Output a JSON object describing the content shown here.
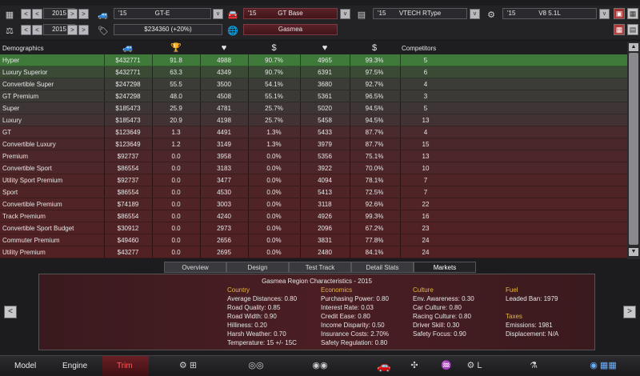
{
  "toolbar": {
    "row1": {
      "year": "2015",
      "model_year": "'15",
      "model": "GT-E",
      "trim_year": "'15",
      "trim": "GT Base",
      "engine_year": "'15",
      "engine": "VTECH RType",
      "engine_family_year": "'15",
      "engine_family": "V8 5.1L"
    },
    "row2": {
      "year": "2015",
      "price": "$234360 (+20%)",
      "region": "Gasmea"
    },
    "prev_glyph": "<",
    "next_glyph": ">",
    "dropdown_glyph": "v"
  },
  "table": {
    "headers": {
      "demographics": "Demographics",
      "competitors": "Competitors"
    },
    "header_icons": [
      "car-icon",
      "trophy-icon",
      "heart-icon",
      "dollar-icon",
      "heart-icon",
      "dollar-icon"
    ],
    "rows": [
      {
        "name": "Hyper",
        "price": "$432771",
        "score": "91.8",
        "appeal": "4988",
        "afford": "90.7%",
        "appeal2": "4965",
        "afford2": "99.3%",
        "competitors": "5"
      },
      {
        "name": "Luxury Superior",
        "price": "$432771",
        "score": "63.3",
        "appeal": "4349",
        "afford": "90.7%",
        "appeal2": "6391",
        "afford2": "97.5%",
        "competitors": "6"
      },
      {
        "name": "Convertible Super",
        "price": "$247298",
        "score": "55.5",
        "appeal": "3500",
        "afford": "54.1%",
        "appeal2": "3680",
        "afford2": "92.7%",
        "competitors": "4"
      },
      {
        "name": "GT Premium",
        "price": "$247298",
        "score": "48.0",
        "appeal": "4508",
        "afford": "55.1%",
        "appeal2": "5361",
        "afford2": "96.5%",
        "competitors": "3"
      },
      {
        "name": "Super",
        "price": "$185473",
        "score": "25.9",
        "appeal": "4781",
        "afford": "25.7%",
        "appeal2": "5020",
        "afford2": "94.5%",
        "competitors": "5"
      },
      {
        "name": "Luxury",
        "price": "$185473",
        "score": "20.9",
        "appeal": "4198",
        "afford": "25.7%",
        "appeal2": "5458",
        "afford2": "94.5%",
        "competitors": "13"
      },
      {
        "name": "GT",
        "price": "$123649",
        "score": "1.3",
        "appeal": "4491",
        "afford": "1.3%",
        "appeal2": "5433",
        "afford2": "87.7%",
        "competitors": "4"
      },
      {
        "name": "Convertible Luxury",
        "price": "$123649",
        "score": "1.2",
        "appeal": "3149",
        "afford": "1.3%",
        "appeal2": "3979",
        "afford2": "87.7%",
        "competitors": "15"
      },
      {
        "name": "Premium",
        "price": "$92737",
        "score": "0.0",
        "appeal": "3958",
        "afford": "0.0%",
        "appeal2": "5356",
        "afford2": "75.1%",
        "competitors": "13"
      },
      {
        "name": "Convertible Sport",
        "price": "$86554",
        "score": "0.0",
        "appeal": "3183",
        "afford": "0.0%",
        "appeal2": "3922",
        "afford2": "70.0%",
        "competitors": "10"
      },
      {
        "name": "Utility Sport Premium",
        "price": "$92737",
        "score": "0.0",
        "appeal": "3477",
        "afford": "0.0%",
        "appeal2": "4094",
        "afford2": "78.1%",
        "competitors": "7"
      },
      {
        "name": "Sport",
        "price": "$86554",
        "score": "0.0",
        "appeal": "4530",
        "afford": "0.0%",
        "appeal2": "5413",
        "afford2": "72.5%",
        "competitors": "7"
      },
      {
        "name": "Convertible Premium",
        "price": "$74189",
        "score": "0.0",
        "appeal": "3003",
        "afford": "0.0%",
        "appeal2": "3118",
        "afford2": "92.6%",
        "competitors": "22"
      },
      {
        "name": "Track Premium",
        "price": "$86554",
        "score": "0.0",
        "appeal": "4240",
        "afford": "0.0%",
        "appeal2": "4926",
        "afford2": "99.3%",
        "competitors": "16"
      },
      {
        "name": "Convertible Sport Budget",
        "price": "$30912",
        "score": "0.0",
        "appeal": "2973",
        "afford": "0.0%",
        "appeal2": "2096",
        "afford2": "67.2%",
        "competitors": "23"
      },
      {
        "name": "Commuter Premium",
        "price": "$49460",
        "score": "0.0",
        "appeal": "2656",
        "afford": "0.0%",
        "appeal2": "3831",
        "afford2": "77.8%",
        "competitors": "24"
      },
      {
        "name": "Utility Premium",
        "price": "$43277",
        "score": "0.0",
        "appeal": "2695",
        "afford": "0.0%",
        "appeal2": "2480",
        "afford2": "84.1%",
        "competitors": "24"
      }
    ],
    "row_colors": [
      "#3f7a3a",
      "#3a4a35",
      "#3b3b37",
      "#3c3a36",
      "#3e3636",
      "#423233",
      "#4a2a2c",
      "#4a282a",
      "#4d2629",
      "#4d2629",
      "#4f2427",
      "#4f2427",
      "#502326",
      "#502326",
      "#512225",
      "#512225",
      "#522124"
    ]
  },
  "tabs": [
    "Overview",
    "Design",
    "Test Track",
    "Detail Stats",
    "Markets"
  ],
  "region": {
    "title": "Gasmea Region Characteristics - 2015",
    "country": {
      "heading": "Country",
      "items": [
        "Average Distances: 0.80",
        "Road Quality: 0.85",
        "Road Width: 0.90",
        "Hilliness: 0.20",
        "Harsh Weather: 0.70",
        "Temperature: 15 +/- 15C"
      ]
    },
    "economics": {
      "heading": "Economics",
      "items": [
        "Purchasing Power: 0.80",
        "Interest Rate: 0.03",
        "Credit Ease: 0.80",
        "Income Disparity: 0.50",
        "Insurance Costs: 2.70%",
        "Safety Regulation: 0.80"
      ]
    },
    "culture": {
      "heading": "Culture",
      "items": [
        "Env. Awareness: 0.30",
        "Car Culture: 0.80",
        "Racing Culture: 0.80",
        "Driver Skill: 0.30",
        "Safety Focus: 0.90"
      ]
    },
    "fuel": {
      "heading": "Fuel",
      "items": [
        "Leaded Ban: 1979"
      ]
    },
    "taxes": {
      "heading": "Taxes",
      "items": [
        "Emissions: 1981",
        "Displacement: N/A"
      ]
    }
  },
  "bottom_bar": {
    "model": "Model",
    "engine": "Engine",
    "trim": "Trim"
  },
  "colors": {
    "accent_red": "#ff5a5a",
    "heading_gold": "#e6b740",
    "top_row_green": "#3f7a3a"
  }
}
